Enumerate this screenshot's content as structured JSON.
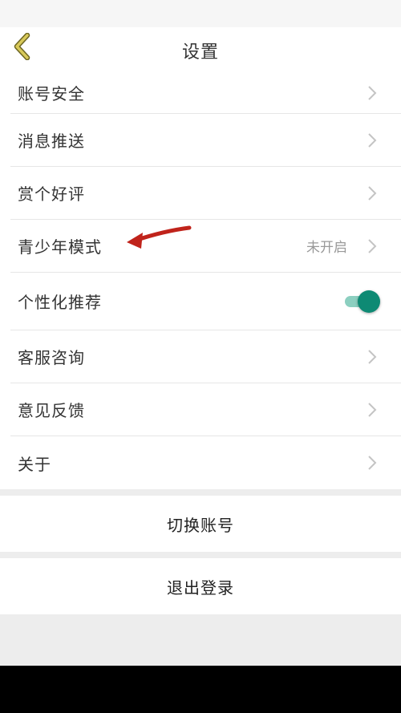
{
  "header": {
    "title": "设置",
    "back_icon": "chevron-left-icon",
    "back_color": "#c8b84a"
  },
  "settings": {
    "items": [
      {
        "label": "账号安全",
        "value": "",
        "control": "chevron"
      },
      {
        "label": "消息推送",
        "value": "",
        "control": "chevron"
      },
      {
        "label": "赏个好评",
        "value": "",
        "control": "chevron"
      },
      {
        "label": "青少年模式",
        "value": "未开启",
        "control": "chevron"
      },
      {
        "label": "个性化推荐",
        "value": "",
        "control": "toggle",
        "toggle_on": true
      },
      {
        "label": "客服咨询",
        "value": "",
        "control": "chevron"
      },
      {
        "label": "意见反馈",
        "value": "",
        "control": "chevron"
      },
      {
        "label": "关于",
        "value": "",
        "control": "chevron"
      }
    ]
  },
  "actions": {
    "switch_account": "切换账号",
    "logout": "退出登录"
  },
  "colors": {
    "accent": "#0e8a74",
    "annotation_arrow": "#c0231b"
  }
}
